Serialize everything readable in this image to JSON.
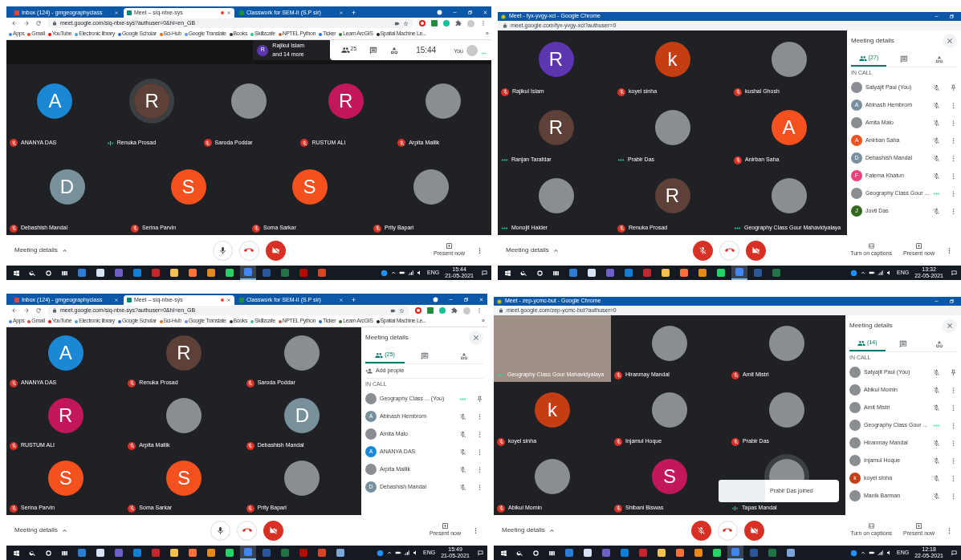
{
  "panels": [
    {
      "chrome": {
        "kind": "tabs",
        "tabs": [
          {
            "title": "Inbox (124) - gmgeographyclass",
            "color": "#ea4335",
            "selected": false,
            "recording": false
          },
          {
            "title": "Meet – siq-ntxe-sys",
            "color": "#00897b",
            "selected": true,
            "recording": true
          },
          {
            "title": "Classwork for SEM-II (S.P sir)",
            "color": "#1e8e3e",
            "selected": false,
            "recording": false
          }
        ],
        "new_tab": "+",
        "url": "meet.google.com/siq-ntxe-sys?authuser=0&hl=en_GB",
        "bookmarks": [
          {
            "label": "Apps",
            "color": "#4285f4"
          },
          {
            "label": "Gmail",
            "color": "#ea4335"
          },
          {
            "label": "YouTube",
            "color": "#ff0000"
          },
          {
            "label": "Electronic library",
            "color": "#4aa3df"
          },
          {
            "label": "Google Scholar",
            "color": "#3367d6"
          },
          {
            "label": "Sci-Hub",
            "color": "#e8710a"
          },
          {
            "label": "Google Translate",
            "color": "#5e97f6"
          },
          {
            "label": "Books",
            "color": "#333333"
          },
          {
            "label": "Skillzcafe",
            "color": "#34c38f"
          },
          {
            "label": "NPTEL Python",
            "color": "#c0623b"
          },
          {
            "label": "Ticker",
            "color": "#1a73e8"
          },
          {
            "label": "Learn ArcGIS",
            "color": "#2e7d32"
          },
          {
            "label": "Spatial Machine Le...",
            "color": "#222222"
          }
        ],
        "more_bookmarks": "»"
      },
      "top_bar": {
        "presenter_avatar": {
          "kind": "letter",
          "letter": "R",
          "color": "#5e35b1"
        },
        "presenter": "Rajikul Islam",
        "presenter_more": "and 14 more",
        "people_count": "25",
        "clock": "15:44",
        "self_label": "You"
      },
      "rows": [
        [
          {
            "name": "ANANYA DAS",
            "kind": "muted",
            "avatar": {
              "kind": "letter",
              "letter": "A",
              "color": "#1a88d4"
            }
          },
          {
            "name": "Renuka Prosad",
            "kind": "audio",
            "avatar": {
              "kind": "letter",
              "letter": "R",
              "color": "#5d4037"
            }
          },
          {
            "name": "Saroda Poddar",
            "kind": "muted",
            "avatar": {
              "kind": "photo"
            }
          },
          {
            "name": "RUSTUM ALI",
            "kind": "muted",
            "avatar": {
              "kind": "letter",
              "letter": "R",
              "color": "#c2185b"
            }
          },
          {
            "name": "Arpita Mallik",
            "kind": "muted",
            "avatar": {
              "kind": "photo"
            }
          }
        ],
        [
          {
            "name": "Debashish Mandal",
            "kind": "muted",
            "avatar": {
              "kind": "letter",
              "letter": "D",
              "color": "#78909c"
            }
          },
          {
            "name": "Serina Parvin",
            "kind": "muted",
            "avatar": {
              "kind": "letter",
              "letter": "S",
              "color": "#f4511e"
            }
          },
          {
            "name": "Soma Sarkar",
            "kind": "muted",
            "avatar": {
              "kind": "letter",
              "letter": "S",
              "color": "#f4511e"
            }
          },
          {
            "name": "Prity Bapari",
            "kind": "muted",
            "avatar": {
              "kind": "photo"
            }
          }
        ]
      ],
      "controls": {
        "meeting_details": "Meeting details",
        "mic_muted": false,
        "present": "Present now"
      },
      "taskbar": {
        "apps": [
          {
            "color": "#2d7dd2",
            "selected": false
          },
          {
            "color": "#d7e3f4",
            "selected": false
          },
          {
            "color": "#6f5fc9",
            "selected": false
          },
          {
            "color": "#0f7fd8",
            "selected": false
          },
          {
            "color": "#c4262e",
            "selected": false
          },
          {
            "color": "#f2c14e",
            "selected": false
          },
          {
            "color": "#ff7139",
            "selected": false
          },
          {
            "color": "#e88a1a",
            "selected": false
          },
          {
            "color": "#25d366",
            "selected": false
          },
          {
            "color": "#4285f4",
            "selected": true
          },
          {
            "color": "#2b579a",
            "selected": false
          },
          {
            "color": "#217346",
            "selected": false
          },
          {
            "color": "#b30b00",
            "selected": false
          },
          {
            "color": "#d24726",
            "selected": false
          }
        ],
        "language": "ENG",
        "time": "15:44",
        "date": "21-05-2021"
      }
    },
    {
      "chrome": {
        "kind": "window",
        "title": "Meet - fyx-yvgy-xci - Google Chrome",
        "url": "meet.google.com/fyx-yvgy-xci?authuser=0"
      },
      "rows": [
        [
          {
            "name": "Rajikul Islam",
            "kind": "muted",
            "avatar": {
              "kind": "letter",
              "letter": "R",
              "color": "#5e35b1"
            }
          },
          {
            "name": "koyel sinha",
            "kind": "muted",
            "avatar": {
              "kind": "letter",
              "letter": "k",
              "color": "#c53d13"
            }
          },
          {
            "name": "kushal Ghosh",
            "kind": "muted",
            "avatar": {
              "kind": "photo"
            }
          }
        ],
        [
          {
            "name": "Ranjan Tarafdar",
            "kind": "dots",
            "avatar": {
              "kind": "letter",
              "letter": "R",
              "color": "#5d4037"
            }
          },
          {
            "name": "Prabir Das",
            "kind": "dots",
            "avatar": {
              "kind": "photo"
            }
          },
          {
            "name": "Anirban Saha",
            "kind": "muted",
            "avatar": {
              "kind": "letter",
              "letter": "A",
              "color": "#f4511e"
            }
          }
        ],
        [
          {
            "name": "Monojit Halder",
            "kind": "dots",
            "avatar": {
              "kind": "photo"
            }
          },
          {
            "name": "Renuka Prosad",
            "kind": "muted",
            "avatar": {
              "kind": "letter",
              "letter": "R",
              "color": "#5d4037"
            }
          },
          {
            "name": "Geography Class Gour Mahavidyalaya",
            "kind": "dots",
            "avatar": {
              "kind": "photo"
            }
          }
        ]
      ],
      "side_panel": {
        "title": "Meeting details",
        "tabs": [
          {
            "kind": "people",
            "count": "(27)",
            "selected": true
          },
          {
            "kind": "chat",
            "selected": false
          },
          {
            "kind": "activities",
            "selected": false
          }
        ],
        "section": "IN CALL",
        "people": [
          {
            "name": "Satyajit Paul (You)",
            "kind": "muted",
            "pinnable": true,
            "avatar": {
              "kind": "photo"
            }
          },
          {
            "name": "Abinash Hembrom",
            "kind": "muted",
            "pinnable": false,
            "avatar": {
              "kind": "letter",
              "letter": "A",
              "color": "#78909c"
            }
          },
          {
            "name": "Amita Malo",
            "kind": "muted",
            "pinnable": false,
            "avatar": {
              "kind": "photo"
            }
          },
          {
            "name": "Anirban Saha",
            "kind": "muted",
            "pinnable": false,
            "avatar": {
              "kind": "letter",
              "letter": "A",
              "color": "#f4511e"
            }
          },
          {
            "name": "Debashish Mandal",
            "kind": "muted",
            "pinnable": false,
            "avatar": {
              "kind": "letter",
              "letter": "D",
              "color": "#78909c"
            }
          },
          {
            "name": "Fatema Khatun",
            "kind": "muted",
            "pinnable": false,
            "avatar": {
              "kind": "letter",
              "letter": "F",
              "color": "#ec407a"
            }
          },
          {
            "name": "Geography Class Gour ...",
            "kind": "dots",
            "pinnable": false,
            "avatar": {
              "kind": "photo"
            }
          },
          {
            "name": "Jovti Das",
            "kind": "muted",
            "pinnable": false,
            "avatar": {
              "kind": "letter",
              "letter": "J",
              "color": "#33691e"
            }
          }
        ]
      },
      "controls": {
        "meeting_details": "Meeting details",
        "mic_muted": true,
        "captions": "Turn on captions",
        "present": "Present now"
      },
      "taskbar": {
        "apps": [
          {
            "color": "#2d7dd2",
            "selected": false
          },
          {
            "color": "#d7e3f4",
            "selected": false
          },
          {
            "color": "#6f5fc9",
            "selected": false
          },
          {
            "color": "#0f7fd8",
            "selected": false
          },
          {
            "color": "#c4262e",
            "selected": false
          },
          {
            "color": "#f2c14e",
            "selected": false
          },
          {
            "color": "#ff7139",
            "selected": false
          },
          {
            "color": "#e88a1a",
            "selected": false
          },
          {
            "color": "#25d366",
            "selected": false
          },
          {
            "color": "#4285f4",
            "selected": true
          },
          {
            "color": "#2b579a",
            "selected": false
          },
          {
            "color": "#217346",
            "selected": false
          }
        ],
        "language": "ENG",
        "time": "13:32",
        "date": "22-05-2021"
      }
    },
    {
      "chrome": {
        "kind": "tabs",
        "tabs": [
          {
            "title": "Inbox (124) - gmgeographyclass",
            "color": "#ea4335",
            "selected": false,
            "recording": false
          },
          {
            "title": "Meet – siq-ntxe-sys",
            "color": "#00897b",
            "selected": true,
            "recording": true
          },
          {
            "title": "Classwork for SEM-II (S.P sir)",
            "color": "#1e8e3e",
            "selected": false,
            "recording": false
          }
        ],
        "new_tab": "+",
        "url": "meet.google.com/siq-ntxe-sys?authuser=0&hl=en_GB",
        "bookmarks": [
          {
            "label": "Apps",
            "color": "#4285f4"
          },
          {
            "label": "Gmail",
            "color": "#ea4335"
          },
          {
            "label": "YouTube",
            "color": "#ff0000"
          },
          {
            "label": "Electronic library",
            "color": "#4aa3df"
          },
          {
            "label": "Google Scholar",
            "color": "#3367d6"
          },
          {
            "label": "Sci-Hub",
            "color": "#e8710a"
          },
          {
            "label": "Google Translate",
            "color": "#5e97f6"
          },
          {
            "label": "Books",
            "color": "#333333"
          },
          {
            "label": "Skillzcafe",
            "color": "#34c38f"
          },
          {
            "label": "NPTEL Python",
            "color": "#c0623b"
          },
          {
            "label": "Ticker",
            "color": "#1a73e8"
          },
          {
            "label": "Learn ArcGIS",
            "color": "#2e7d32"
          },
          {
            "label": "Spatial Machine Le...",
            "color": "#222222"
          }
        ],
        "more_bookmarks": "»"
      },
      "rows": [
        [
          {
            "name": "ANANYA DAS",
            "kind": "muted",
            "avatar": {
              "kind": "letter",
              "letter": "A",
              "color": "#1a88d4"
            }
          },
          {
            "name": "Renuka Prosad",
            "kind": "muted",
            "avatar": {
              "kind": "letter",
              "letter": "R",
              "color": "#5d4037"
            }
          },
          {
            "name": "Saroda Poddar",
            "kind": "muted",
            "avatar": {
              "kind": "photo"
            }
          }
        ],
        [
          {
            "name": "RUSTUM ALI",
            "kind": "muted",
            "avatar": {
              "kind": "letter",
              "letter": "R",
              "color": "#c2185b"
            }
          },
          {
            "name": "Arpita Mallik",
            "kind": "muted",
            "avatar": {
              "kind": "photo"
            }
          },
          {
            "name": "Debashish Mandal",
            "kind": "muted",
            "avatar": {
              "kind": "letter",
              "letter": "D",
              "color": "#78909c"
            }
          }
        ],
        [
          {
            "name": "Serina Parvin",
            "kind": "muted",
            "avatar": {
              "kind": "letter",
              "letter": "S",
              "color": "#f4511e"
            }
          },
          {
            "name": "Soma Sarkar",
            "kind": "muted",
            "avatar": {
              "kind": "letter",
              "letter": "S",
              "color": "#f4511e"
            }
          },
          {
            "name": "Prity Bapari",
            "kind": "muted",
            "avatar": {
              "kind": "photo"
            }
          }
        ]
      ],
      "side_panel": {
        "title": "Meeting details",
        "tabs": [
          {
            "kind": "people",
            "count": "(25)",
            "selected": true
          },
          {
            "kind": "chat",
            "selected": false
          },
          {
            "kind": "activities",
            "selected": false
          }
        ],
        "add_people": "Add people",
        "section": "IN CALL",
        "people": [
          {
            "name": "Geography Class ... (You)",
            "kind": "dots",
            "pinnable": true,
            "avatar": {
              "kind": "photo"
            }
          },
          {
            "name": "Abinash Hembrom",
            "kind": "muted",
            "pinnable": false,
            "avatar": {
              "kind": "letter",
              "letter": "A",
              "color": "#78909c"
            }
          },
          {
            "name": "Amita Malo",
            "kind": "muted",
            "pinnable": false,
            "avatar": {
              "kind": "photo"
            }
          },
          {
            "name": "ANANYA DAS",
            "kind": "muted",
            "pinnable": false,
            "avatar": {
              "kind": "letter",
              "letter": "A",
              "color": "#1a88d4"
            }
          },
          {
            "name": "Arpita Mallik",
            "kind": "muted",
            "pinnable": false,
            "avatar": {
              "kind": "photo"
            }
          },
          {
            "name": "Debashish Mandal",
            "kind": "muted",
            "pinnable": false,
            "avatar": {
              "kind": "letter",
              "letter": "D",
              "color": "#78909c"
            }
          }
        ]
      },
      "controls": {
        "meeting_details": "Meeting details",
        "mic_muted": false,
        "present": "Present now"
      },
      "taskbar": {
        "apps": [
          {
            "color": "#2d7dd2",
            "selected": false
          },
          {
            "color": "#d7e3f4",
            "selected": false
          },
          {
            "color": "#6f5fc9",
            "selected": false
          },
          {
            "color": "#0f7fd8",
            "selected": false
          },
          {
            "color": "#c4262e",
            "selected": false
          },
          {
            "color": "#f2c14e",
            "selected": false
          },
          {
            "color": "#ff7139",
            "selected": false
          },
          {
            "color": "#e88a1a",
            "selected": false
          },
          {
            "color": "#25d366",
            "selected": false
          },
          {
            "color": "#4285f4",
            "selected": true
          },
          {
            "color": "#2b579a",
            "selected": false
          },
          {
            "color": "#217346",
            "selected": false
          },
          {
            "color": "#b30b00",
            "selected": false
          },
          {
            "color": "#d24726",
            "selected": false
          },
          {
            "color": "#7aa7d8",
            "selected": false
          }
        ],
        "language": "ENG",
        "time": "15:49",
        "date": "21-05-2021"
      }
    },
    {
      "chrome": {
        "kind": "window",
        "title": "Meet - zep-ycmc-but - Google Chrome",
        "url": "meet.google.com/zep-ycmc-but?authuser=0"
      },
      "rows": [
        [
          {
            "name": "Geography Class Gour Mahavidyalaya",
            "kind": "dots",
            "avatar": {
              "kind": "video"
            }
          },
          {
            "name": "Hiranmay Mandal",
            "kind": "muted",
            "avatar": {
              "kind": "photo"
            }
          },
          {
            "name": "Amit Mistri",
            "kind": "muted",
            "avatar": {
              "kind": "photo"
            }
          }
        ],
        [
          {
            "name": "koyel sinha",
            "kind": "muted",
            "avatar": {
              "kind": "letter",
              "letter": "k",
              "color": "#c53d13"
            }
          },
          {
            "name": "Injamul Hoque",
            "kind": "muted",
            "avatar": {
              "kind": "photo"
            }
          },
          {
            "name": "Prabir Das",
            "kind": "muted",
            "avatar": {
              "kind": "photo"
            }
          }
        ],
        [
          {
            "name": "Abikul Momin",
            "kind": "muted",
            "avatar": {
              "kind": "photo"
            }
          },
          {
            "name": "Shibani Biswas",
            "kind": "muted",
            "avatar": {
              "kind": "letter",
              "letter": "S",
              "color": "#c2185b"
            }
          },
          {
            "name": "Tapas Mandal",
            "kind": "audio",
            "avatar": {
              "kind": "photo"
            }
          }
        ]
      ],
      "toast": "Prabir Das joined",
      "side_panel": {
        "title": "Meeting details",
        "tabs": [
          {
            "kind": "people",
            "count": "(14)",
            "selected": true
          },
          {
            "kind": "chat",
            "selected": false
          },
          {
            "kind": "activities",
            "selected": false
          }
        ],
        "section": "IN CALL",
        "people": [
          {
            "name": "Satyajit Paul (You)",
            "kind": "muted",
            "pinnable": true,
            "avatar": {
              "kind": "photo"
            }
          },
          {
            "name": "Abikul Momin",
            "kind": "muted",
            "pinnable": false,
            "avatar": {
              "kind": "photo"
            }
          },
          {
            "name": "Amit Mistri",
            "kind": "muted",
            "pinnable": false,
            "avatar": {
              "kind": "photo"
            }
          },
          {
            "name": "Geography Class Gour ...",
            "kind": "dots",
            "pinnable": false,
            "avatar": {
              "kind": "photo"
            }
          },
          {
            "name": "Hiranmay Mandal",
            "kind": "muted",
            "pinnable": false,
            "avatar": {
              "kind": "photo"
            }
          },
          {
            "name": "Injamul Hoque",
            "kind": "muted",
            "pinnable": false,
            "avatar": {
              "kind": "photo"
            }
          },
          {
            "name": "koyel sinha",
            "kind": "muted",
            "pinnable": false,
            "avatar": {
              "kind": "letter",
              "letter": "k",
              "color": "#c53d13"
            }
          },
          {
            "name": "Manik Barman",
            "kind": "muted",
            "pinnable": false,
            "avatar": {
              "kind": "photo"
            }
          }
        ]
      },
      "controls": {
        "meeting_details": "Meeting details",
        "mic_muted": true,
        "captions": "Turn on captions",
        "present": "Present now"
      },
      "taskbar": {
        "apps": [
          {
            "color": "#2d7dd2",
            "selected": false
          },
          {
            "color": "#d7e3f4",
            "selected": false
          },
          {
            "color": "#6f5fc9",
            "selected": false
          },
          {
            "color": "#0f7fd8",
            "selected": false
          },
          {
            "color": "#c4262e",
            "selected": false
          },
          {
            "color": "#f2c14e",
            "selected": false
          },
          {
            "color": "#ff7139",
            "selected": false
          },
          {
            "color": "#e88a1a",
            "selected": false
          },
          {
            "color": "#25d366",
            "selected": false
          },
          {
            "color": "#4285f4",
            "selected": true
          },
          {
            "color": "#2b579a",
            "selected": false
          },
          {
            "color": "#217346",
            "selected": false
          },
          {
            "color": "#7aa7d8",
            "selected": false
          }
        ],
        "language": "ENG",
        "time": "12:18",
        "date": "22-05-2021"
      }
    }
  ]
}
